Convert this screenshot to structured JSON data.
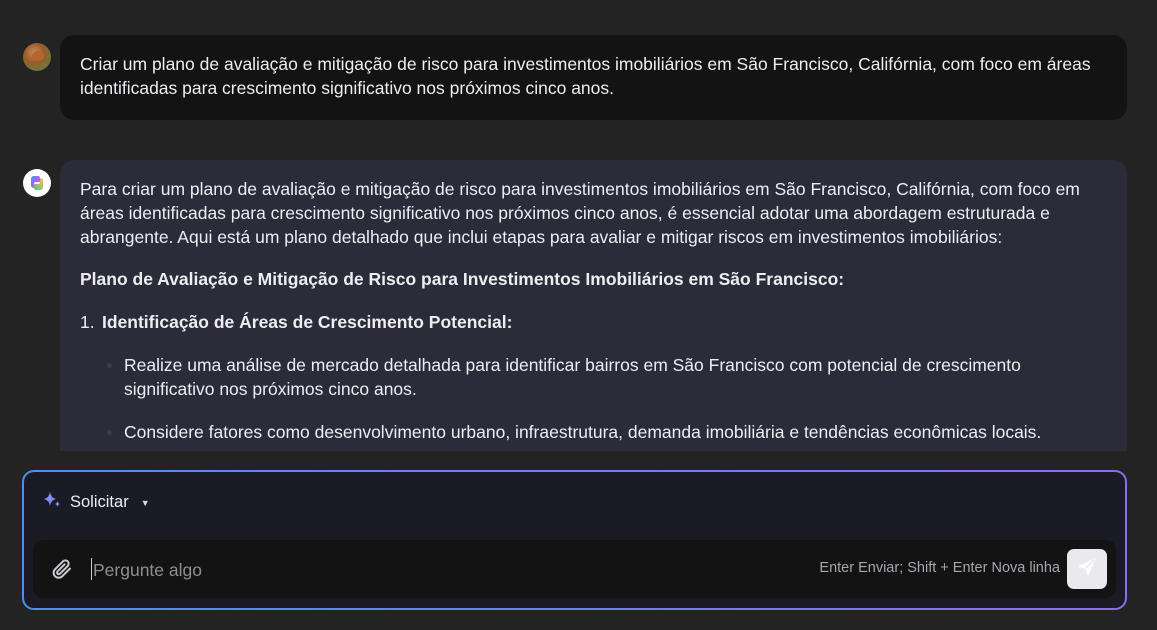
{
  "conversation": {
    "user_message": "Criar um plano de avaliação e mitigação de risco para investimentos imobiliários em São Francisco, Califórnia, com foco em áreas identificadas para crescimento significativo nos próximos cinco anos.",
    "ai_response": {
      "intro": "Para criar um plano de avaliação e mitigação de risco para investimentos imobiliários em São Francisco, Califórnia, com foco em áreas identificadas para crescimento significativo nos próximos cinco anos, é essencial adotar uma abordagem estruturada e abrangente. Aqui está um plano detalhado que inclui etapas para avaliar e mitigar riscos em investimentos imobiliários:",
      "heading": "Plano de Avaliação e Mitigação de Risco para Investimentos Imobiliários em São Francisco:",
      "step_number": "1.",
      "step_title": "Identificação de Áreas de Crescimento Potencial:",
      "bullets": [
        "Realize uma análise de mercado detalhada para identificar bairros em São Francisco com potencial de crescimento significativo nos próximos cinco anos.",
        "Considere fatores como desenvolvimento urbano, infraestrutura, demanda imobiliária e tendências econômicas locais."
      ]
    }
  },
  "composer": {
    "mode_label": "Solicitar",
    "input_placeholder": "Pergunte algo",
    "input_value": "",
    "hint": "Enter Enviar; Shift + Enter Nova linha"
  },
  "icons": {
    "mode": "sparkle-icon",
    "mode_caret": "caret-down-icon",
    "attach": "paperclip-icon",
    "send": "send-icon",
    "ai_avatar": "copilot-logo-icon"
  },
  "colors": {
    "page_bg": "#232324",
    "user_bubble": "#131314",
    "ai_bubble": "#2b2b3a",
    "composer_border_start": "#4f8fe8",
    "composer_border_end": "#8b6ee8"
  }
}
